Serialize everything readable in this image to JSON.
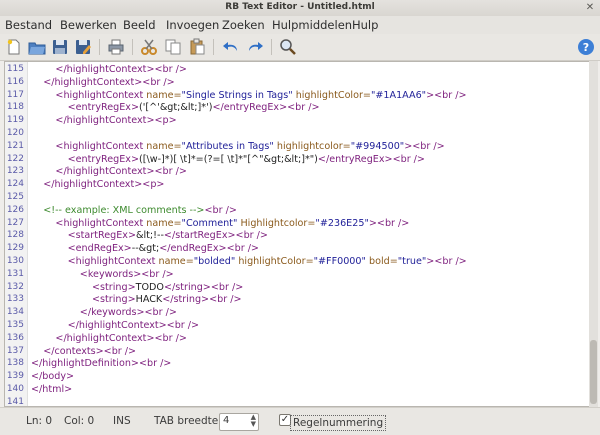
{
  "window": {
    "title": "RB Text Editor - Untitled.html"
  },
  "menu": [
    "Bestand",
    "Bewerken",
    "Beeld",
    "Invoegen",
    "Zoeken",
    "Hulpmiddelen",
    "Hulp"
  ],
  "toolbar": {
    "icons": [
      "new-file-icon",
      "open-folder-icon",
      "save-icon",
      "save-as-icon",
      "print-icon",
      "cut-icon",
      "copy-icon",
      "paste-icon",
      "undo-icon",
      "redo-icon",
      "search-icon",
      "help-icon"
    ]
  },
  "editor": {
    "lines": [
      {
        "n": "115",
        "html": "        <span class='t'>&lt;/highlightContext&gt;&lt;br /&gt;</span>"
      },
      {
        "n": "116",
        "html": "    <span class='t'>&lt;/highlightContext&gt;&lt;br /&gt;</span>"
      },
      {
        "n": "117",
        "html": "        <span class='t'>&lt;highlightContext</span> <span class='a'>name=</span><span class='v'>\"Single Strings in Tags\"</span> <span class='a'>highlightColor=</span><span class='v'>\"#1A1AA6\"</span><span class='t'>&gt;&lt;br /&gt;</span>"
      },
      {
        "n": "118",
        "html": "            <span class='t'>&lt;entryRegEx&gt;</span><span class='x'>('[^'&amp;gt;&amp;lt;]*')</span><span class='t'>&lt;/entryRegEx&gt;&lt;br /&gt;</span>"
      },
      {
        "n": "119",
        "html": "        <span class='t'>&lt;/highlightContext&gt;&lt;p&gt;</span>"
      },
      {
        "n": "120",
        "html": ""
      },
      {
        "n": "121",
        "html": "        <span class='t'>&lt;highlightContext</span> <span class='a'>name=</span><span class='v'>\"Attributes in Tags\"</span> <span class='a'>highlightcolor=</span><span class='v'>\"#994500\"</span><span class='t'>&gt;&lt;br /&gt;</span>"
      },
      {
        "n": "122",
        "html": "            <span class='t'>&lt;entryRegEx&gt;</span><span class='x'>([\\w-]*)[ \\t]*=(?=[ \\t]*\"[^\"&amp;gt;&amp;lt;]*\")</span><span class='t'>&lt;/entryRegEx&gt;&lt;br /&gt;</span>"
      },
      {
        "n": "123",
        "html": "        <span class='t'>&lt;/highlightContext&gt;&lt;br /&gt;</span>"
      },
      {
        "n": "124",
        "html": "    <span class='t'>&lt;/highlightContext&gt;&lt;p&gt;</span>"
      },
      {
        "n": "125",
        "html": ""
      },
      {
        "n": "126",
        "html": "    <span class='c'>&lt;!-- example: XML comments --&gt;</span><span class='t'>&lt;br /&gt;</span>"
      },
      {
        "n": "127",
        "html": "        <span class='t'>&lt;highlightContext</span> <span class='a'>name=</span><span class='v'>\"Comment\"</span> <span class='a'>Highlightcolor=</span><span class='v'>\"#236E25\"</span><span class='t'>&gt;&lt;br /&gt;</span>"
      },
      {
        "n": "128",
        "html": "            <span class='t'>&lt;startRegEx&gt;</span><span class='x'>&amp;lt;!--</span><span class='t'>&lt;/startRegEx&gt;&lt;br /&gt;</span>"
      },
      {
        "n": "129",
        "html": "            <span class='t'>&lt;endRegEx&gt;</span><span class='x'>--&amp;gt;</span><span class='t'>&lt;/endRegEx&gt;&lt;br /&gt;</span>"
      },
      {
        "n": "130",
        "html": "            <span class='t'>&lt;highlightContext</span> <span class='a'>name=</span><span class='v'>\"bolded\"</span> <span class='a'>highlightColor=</span><span class='v'>\"#FF0000\"</span> <span class='a'>bold=</span><span class='v'>\"true\"</span><span class='t'>&gt;&lt;br /&gt;</span>"
      },
      {
        "n": "131",
        "html": "                <span class='t'>&lt;keywords&gt;&lt;br /&gt;</span>"
      },
      {
        "n": "132",
        "html": "                    <span class='t'>&lt;string&gt;</span><span class='x'>TODO</span><span class='t'>&lt;/string&gt;&lt;br /&gt;</span>"
      },
      {
        "n": "133",
        "html": "                    <span class='t'>&lt;string&gt;</span><span class='x'>HACK</span><span class='t'>&lt;/string&gt;&lt;br /&gt;</span>"
      },
      {
        "n": "134",
        "html": "                <span class='t'>&lt;/keywords&gt;&lt;br /&gt;</span>"
      },
      {
        "n": "135",
        "html": "            <span class='t'>&lt;/highlightContext&gt;&lt;br /&gt;</span>"
      },
      {
        "n": "136",
        "html": "        <span class='t'>&lt;/highlightContext&gt;&lt;br /&gt;</span>"
      },
      {
        "n": "137",
        "html": "    <span class='t'>&lt;/contexts&gt;&lt;br /&gt;</span>"
      },
      {
        "n": "138",
        "html": "<span class='t'>&lt;/highlightDefinition&gt;&lt;br /&gt;</span>"
      },
      {
        "n": "139",
        "html": "<span class='t'>&lt;/body&gt;</span>"
      },
      {
        "n": "140",
        "html": "<span class='t'>&lt;/html&gt;</span>"
      },
      {
        "n": "141",
        "html": ""
      }
    ]
  },
  "status": {
    "line": "Ln: 0",
    "col": "Col: 0",
    "mode": "INS",
    "tab_label": "TAB breedte:",
    "tab_value": "4",
    "linenum_label": "Regelnummering",
    "linenum_checked": true
  }
}
